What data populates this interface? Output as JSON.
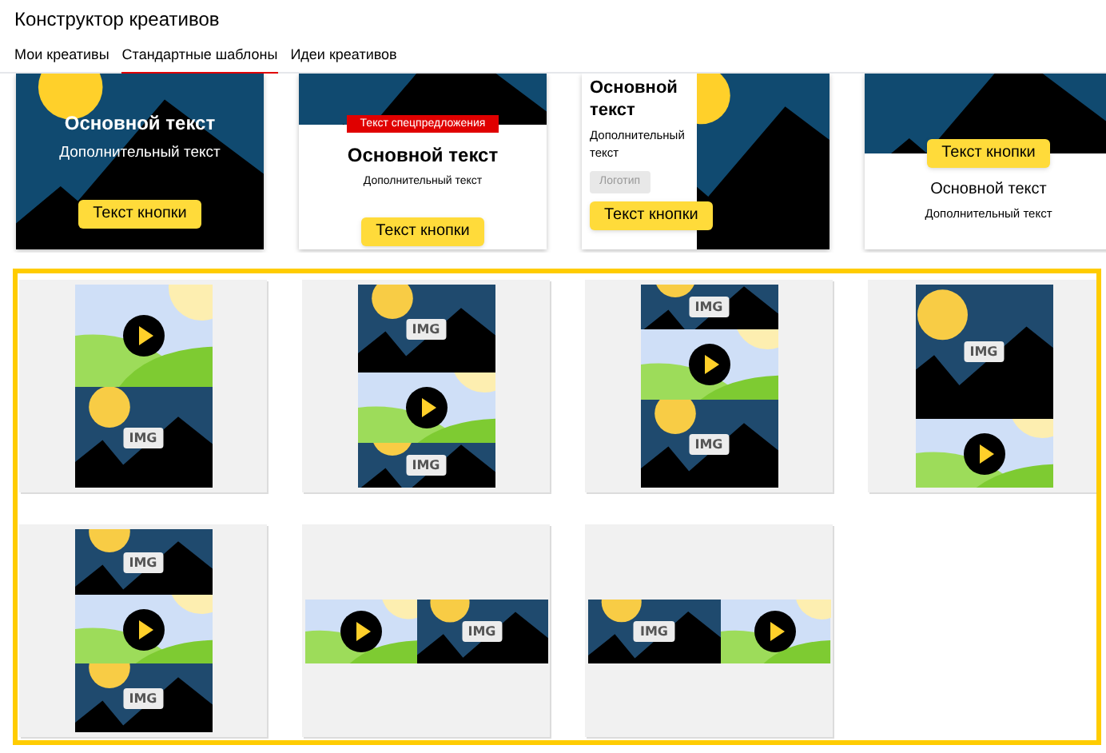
{
  "window": {
    "title": "Конструктор креативов"
  },
  "tabs": [
    {
      "label": "Мои креативы",
      "selected": false
    },
    {
      "label": "Стандартные шаблоны",
      "selected": true
    },
    {
      "label": "Идеи креативов",
      "selected": false
    }
  ],
  "banner_templates": [
    {
      "kind": "overlay",
      "main_text": "Основной текст",
      "extra_text": "Дополнительный текст",
      "button": "Текст кнопки"
    },
    {
      "kind": "offer",
      "offer": "Текст спецпредложения",
      "main_text": "Основной текст",
      "extra_text": "Дополнительный текст",
      "button": "Текст кнопки"
    },
    {
      "kind": "split",
      "main_text": "Основной текст",
      "extra_text": "Дополнительный текст",
      "logo": "Логотип",
      "button": "Текст кнопки"
    },
    {
      "kind": "below",
      "button": "Текст кнопки",
      "main_text": "Основной текст",
      "extra_text": "Дополнительный текст"
    }
  ],
  "media_templates": [
    {
      "kind": "vertical",
      "segments": [
        {
          "kind": "video"
        },
        {
          "kind": "image",
          "label": "IMG"
        }
      ]
    },
    {
      "kind": "vertical",
      "segments": [
        {
          "kind": "image",
          "label": "IMG"
        },
        {
          "kind": "video"
        },
        {
          "kind": "image",
          "label": "IMG"
        }
      ]
    },
    {
      "kind": "vertical",
      "segments": [
        {
          "kind": "image",
          "label": "IMG"
        },
        {
          "kind": "video"
        },
        {
          "kind": "image",
          "label": "IMG"
        }
      ]
    },
    {
      "kind": "vertical",
      "segments": [
        {
          "kind": "image",
          "label": "IMG"
        },
        {
          "kind": "video"
        }
      ]
    },
    {
      "kind": "vertical",
      "segments": [
        {
          "kind": "image",
          "label": "IMG"
        },
        {
          "kind": "video"
        },
        {
          "kind": "image",
          "label": "IMG"
        }
      ]
    },
    {
      "kind": "horizontal",
      "segments": [
        {
          "kind": "video"
        },
        {
          "kind": "image",
          "label": "IMG"
        }
      ]
    },
    {
      "kind": "horizontal",
      "segments": [
        {
          "kind": "image",
          "label": "IMG"
        },
        {
          "kind": "video"
        }
      ]
    }
  ]
}
